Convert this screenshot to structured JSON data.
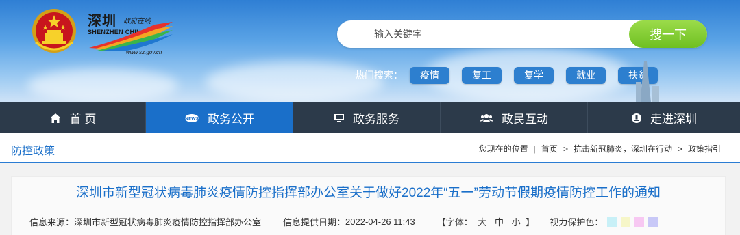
{
  "header": {
    "logo_cn": "深圳",
    "logo_cn_small": "政府在线",
    "logo_en": "SHENZHEN CHINA",
    "logo_url": "www.sz.gov.cn"
  },
  "search": {
    "placeholder": "输入关键字",
    "button_label": "搜一下"
  },
  "hot_search": {
    "label": "热门搜索：",
    "tags": [
      "疫情",
      "复工",
      "复学",
      "就业",
      "扶贫"
    ]
  },
  "nav": {
    "items": [
      {
        "label": "首 页",
        "icon": "home-icon"
      },
      {
        "label": "政务公开",
        "icon": "news-icon"
      },
      {
        "label": "政务服务",
        "icon": "monitor-icon"
      },
      {
        "label": "政民互动",
        "icon": "people-icon"
      },
      {
        "label": "走进深圳",
        "icon": "location-icon"
      }
    ],
    "active_index": 1
  },
  "section": {
    "title": "防控政策"
  },
  "breadcrumb": {
    "prefix": "您现在的位置",
    "items": [
      "首页",
      "抗击新冠肺炎，深圳在行动",
      "政策指引"
    ]
  },
  "article": {
    "title": "深圳市新型冠状病毒肺炎疫情防控指挥部办公室关于做好2022年“五一”劳动节假期疫情防控工作的通知",
    "source_label": "信息来源：",
    "source_value": "深圳市新型冠状病毒肺炎疫情防控指挥部办公室",
    "date_label": "信息提供日期：",
    "date_value": "2022-04-26 11:43",
    "font_label": "【字体：",
    "font_large": "大",
    "font_medium": "中",
    "font_small": "小",
    "font_close": "】",
    "vision_label": "视力保护色：",
    "swatches": [
      "#c8f0f7",
      "#f6f6c8",
      "#f7c8f2",
      "#c8c8f7"
    ]
  },
  "colors": {
    "nav_bg": "#2c3a4a",
    "nav_active": "#1a6fc9",
    "accent_blue": "#1a6fc9",
    "search_green": "#7ac72b"
  }
}
